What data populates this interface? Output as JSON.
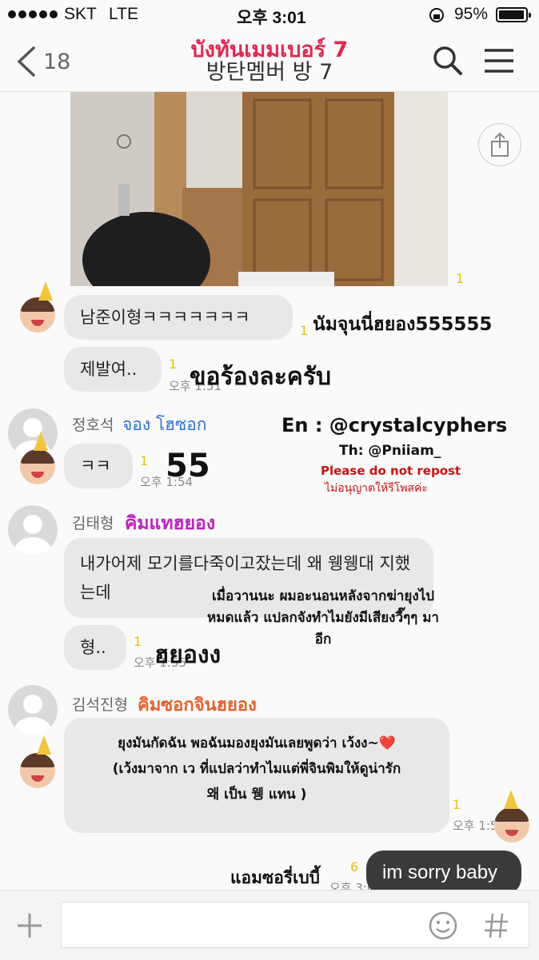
{
  "status_bar": {
    "carrier": "SKT",
    "network": "LTE",
    "time": "오후 3:01",
    "battery": "95%"
  },
  "header": {
    "overlay_title": "บังทันเมมเบอร์ 7",
    "room_title": "방탄멤버 방 7",
    "back_count": "18"
  },
  "photo_message": {
    "unread": "1"
  },
  "watermark": {
    "en": "En : @crystalcyphers",
    "th": "Th: @Pniiam_",
    "repost_en": "Please do not repost",
    "repost_th": "ไม่อนุญาตให้รีโพสค่ะ"
  },
  "messages": [
    {
      "text": "남준이형ㅋㅋㅋㅋㅋㅋㅋ",
      "unread": "1",
      "translation": "นัมจุนนี่ฮยอง555555"
    },
    {
      "text": "제발여..",
      "unread": "1",
      "time": "오후 1:51",
      "translation": "ขอร้องละครับ"
    },
    {
      "sender": "정호석",
      "sender_th": "จอง โฮซอก",
      "text": "ㅋㅋ",
      "unread": "1",
      "time": "오후 1:54",
      "translation": "55"
    },
    {
      "sender": "김태형",
      "sender_th": "คิมแทฮยอง",
      "text": "내가어제 모기를다죽이고잤는데 왜 웽웽대 지했는데",
      "translation": "เมื่อวานนะ ผมอะนอนหลังจากฆ่ายุงไปหมดแล้ว แปลกจังทำไมยังมีเสียงวี๊ๆๆ มาอีก"
    },
    {
      "text": "형..",
      "unread": "1",
      "time": "오후 1:55",
      "translation": "ฮยองง"
    },
    {
      "sender": "김석진형",
      "sender_th": "คิมซอกจินฮยอง",
      "translation_line1": "ยุงมันกัดฉัน พอฉันมองยุงมันเลยพูดว่า เว้งง~❤️",
      "translation_line2": "(เว้งมาจาก เว ที่แปลว่าทำไมแต่พี่จินพิมให้ดูน่ารัก",
      "translation_line3": "왜 เป็น 웽 แทน )",
      "unread": "1",
      "time": "오후 1:5"
    },
    {
      "text": "im sorry baby",
      "unread": "6",
      "time": "오후 3:01",
      "translation": "แอมซอรี่เบบี้"
    }
  ],
  "input_bar": {
    "placeholder": ""
  },
  "icons": [
    "back-chevron-icon",
    "search-icon",
    "menu-icon",
    "share-icon",
    "plus-icon",
    "emoji-icon",
    "hashtag-icon",
    "party-hat-icon"
  ]
}
